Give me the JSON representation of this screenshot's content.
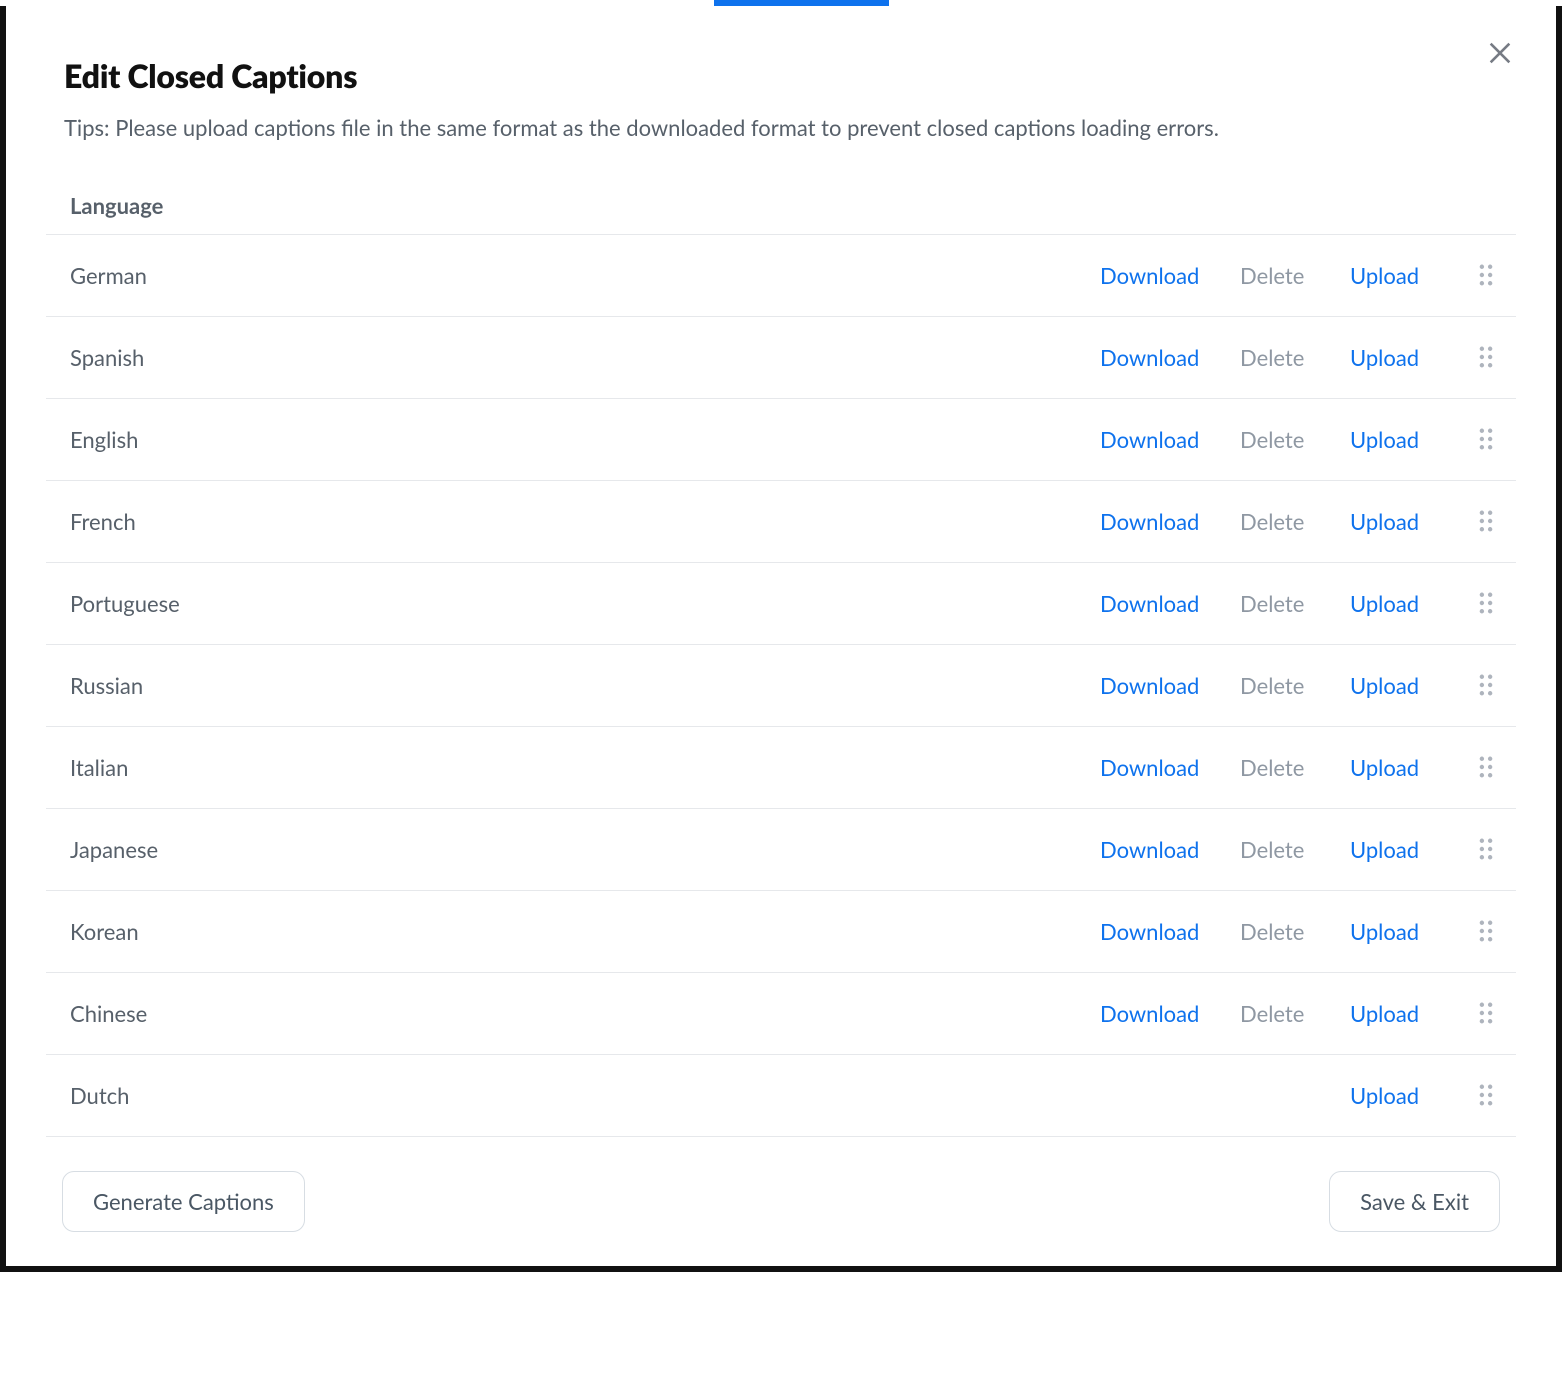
{
  "modal": {
    "title": "Edit Closed Captions",
    "tips": "Tips: Please upload captions file in the same format as the downloaded format to prevent closed captions loading errors."
  },
  "table": {
    "header": {
      "language": "Language"
    },
    "actions": {
      "download": "Download",
      "delete": "Delete",
      "upload": "Upload"
    },
    "rows": [
      {
        "language": "German",
        "has_download": true,
        "has_delete": true,
        "has_upload": true
      },
      {
        "language": "Spanish",
        "has_download": true,
        "has_delete": true,
        "has_upload": true
      },
      {
        "language": "English",
        "has_download": true,
        "has_delete": true,
        "has_upload": true
      },
      {
        "language": "French",
        "has_download": true,
        "has_delete": true,
        "has_upload": true
      },
      {
        "language": "Portuguese",
        "has_download": true,
        "has_delete": true,
        "has_upload": true
      },
      {
        "language": "Russian",
        "has_download": true,
        "has_delete": true,
        "has_upload": true
      },
      {
        "language": "Italian",
        "has_download": true,
        "has_delete": true,
        "has_upload": true
      },
      {
        "language": "Japanese",
        "has_download": true,
        "has_delete": true,
        "has_upload": true
      },
      {
        "language": "Korean",
        "has_download": true,
        "has_delete": true,
        "has_upload": true
      },
      {
        "language": "Chinese",
        "has_download": true,
        "has_delete": true,
        "has_upload": true
      },
      {
        "language": "Dutch",
        "has_download": false,
        "has_delete": false,
        "has_upload": true
      }
    ]
  },
  "footer": {
    "generate": "Generate Captions",
    "save_exit": "Save & Exit"
  }
}
